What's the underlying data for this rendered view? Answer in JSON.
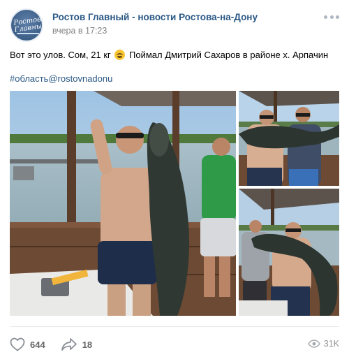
{
  "post": {
    "author": "Ростов Главный - новости Ростова-на-Дону",
    "avatar_text": "Ростов Главный",
    "time": "вчера в 17:23",
    "text": "Вот это улов. Сом, 21 кг",
    "text_after_emoji": "Поймал Дмитрий Сахаров в районе х. Арпачин",
    "emoji_icon": "grinning-face-icon",
    "hashtag": "#область@rostovnadonu"
  },
  "photos": [
    {
      "icon": "photo-man-holding-catfish"
    },
    {
      "icon": "photo-two-men-holding-catfish"
    },
    {
      "icon": "photo-men-holding-catfish-on-deck"
    }
  ],
  "footer": {
    "likes": "644",
    "shares": "18",
    "views": "31K",
    "like_icon": "heart-icon",
    "share_icon": "share-arrow-icon",
    "views_icon": "eye-icon"
  },
  "colors": {
    "link": "#2a5885",
    "meta": "#828282",
    "action": "#656565"
  }
}
